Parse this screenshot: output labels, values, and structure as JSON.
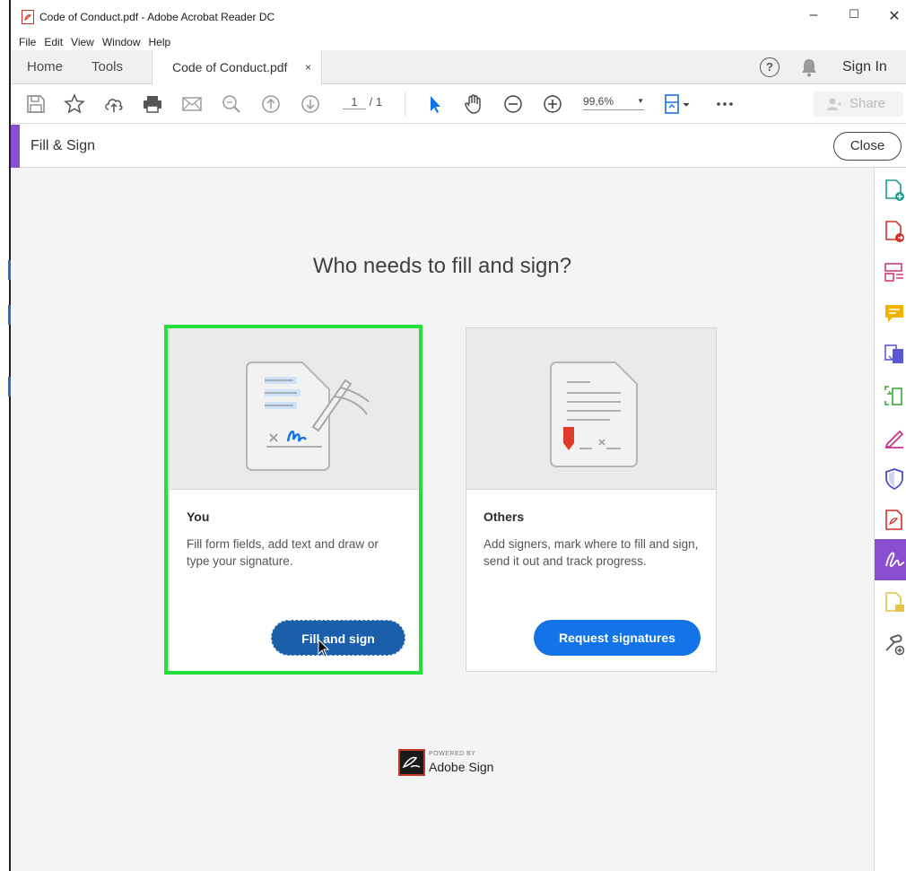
{
  "window": {
    "title": "Code of Conduct.pdf - Adobe Acrobat Reader DC",
    "controls": {
      "minimize": "–",
      "maximize": "☐",
      "close": "✕"
    }
  },
  "menu": [
    "File",
    "Edit",
    "View",
    "Window",
    "Help"
  ],
  "tabs": {
    "home": "Home",
    "tools": "Tools",
    "document": "Code of Conduct.pdf",
    "document_close": "×",
    "sign_in": "Sign In",
    "help": "?"
  },
  "toolbar": {
    "page_current": "1",
    "page_total": "/ 1",
    "zoom": "99,6%",
    "share": "Share"
  },
  "fill_sign": {
    "label": "Fill & Sign",
    "close": "Close"
  },
  "content": {
    "heading": "Who needs to fill and sign?",
    "cards": [
      {
        "title": "You",
        "description": "Fill form fields, add text and draw or type your signature.",
        "button": "Fill and sign"
      },
      {
        "title": "Others",
        "description": "Add signers, mark where to fill and sign, send it out and track progress.",
        "button": "Request signatures"
      }
    ],
    "powered_by": "POWERED BY",
    "brand": "Adobe Sign"
  },
  "colors": {
    "accent_purple": "#8a4fd1",
    "button_blue": "#1473e6",
    "highlight_green": "#22e03a"
  },
  "icons": {
    "toolbar": [
      "save-icon",
      "star-icon",
      "upload-icon",
      "print-icon",
      "mail-icon",
      "search-icon",
      "page-up-icon",
      "page-down-icon",
      "select-arrow-icon",
      "hand-icon",
      "zoom-out-icon",
      "zoom-in-icon",
      "fit-page-icon",
      "more-icon"
    ],
    "right_panel": [
      "create-pdf-icon",
      "export-pdf-icon",
      "organize-pages-icon",
      "comment-icon",
      "combine-files-icon",
      "scan-icon",
      "edit-pdf-icon",
      "protect-icon",
      "pdf-icon",
      "fill-sign-icon",
      "send-review-icon",
      "more-tools-icon"
    ]
  }
}
